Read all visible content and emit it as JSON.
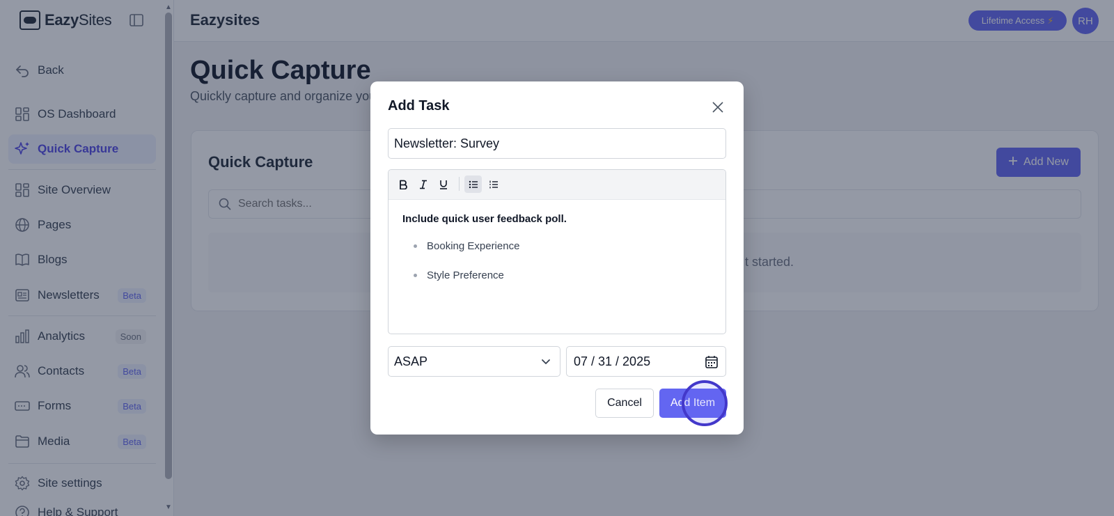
{
  "brand": {
    "name_bold": "Eazy",
    "name_light": "Sites"
  },
  "sidebar": {
    "items": [
      {
        "label": "Back",
        "icon": "back-arrow-icon"
      },
      {
        "label": "OS Dashboard",
        "icon": "dashboard-icon"
      },
      {
        "label": "Quick Capture",
        "icon": "sparkle-icon",
        "active": true
      },
      {
        "label": "Site Overview",
        "icon": "overview-icon"
      },
      {
        "label": "Pages",
        "icon": "globe-icon"
      },
      {
        "label": "Blogs",
        "icon": "book-icon"
      },
      {
        "label": "Newsletters",
        "icon": "newspaper-icon",
        "badge": "Beta"
      },
      {
        "label": "Analytics",
        "icon": "bar-chart-icon",
        "badge": "Soon"
      },
      {
        "label": "Contacts",
        "icon": "users-icon",
        "badge": "Beta"
      },
      {
        "label": "Forms",
        "icon": "form-icon",
        "badge": "Beta"
      },
      {
        "label": "Media",
        "icon": "folder-icon",
        "badge": "Beta"
      },
      {
        "label": "Site settings",
        "icon": "gear-icon"
      },
      {
        "label": "Help & Support",
        "icon": "help-icon"
      }
    ]
  },
  "header": {
    "title": "Eazysites",
    "lifetime_label": "Lifetime Access",
    "lifetime_icon": "⚡",
    "avatar_initials": "RH"
  },
  "main": {
    "title": "Quick Capture",
    "subtitle": "Quickly capture and organize your",
    "card_title": "Quick Capture",
    "add_new_label": "Add New",
    "search_placeholder": "Search tasks...",
    "empty_text": "t started."
  },
  "modal": {
    "title": "Add Task",
    "task_title_value": "Newsletter: Survey",
    "editor": {
      "paragraph": "Include quick user feedback poll.",
      "bullets": [
        "Booking Experience",
        "Style Preference"
      ]
    },
    "priority_value": "ASAP",
    "date_value": "07 / 31 / 2025",
    "cancel_label": "Cancel",
    "submit_label": "Add Item"
  },
  "colors": {
    "accent": "#6366f1",
    "overlay": "#1f2942"
  }
}
